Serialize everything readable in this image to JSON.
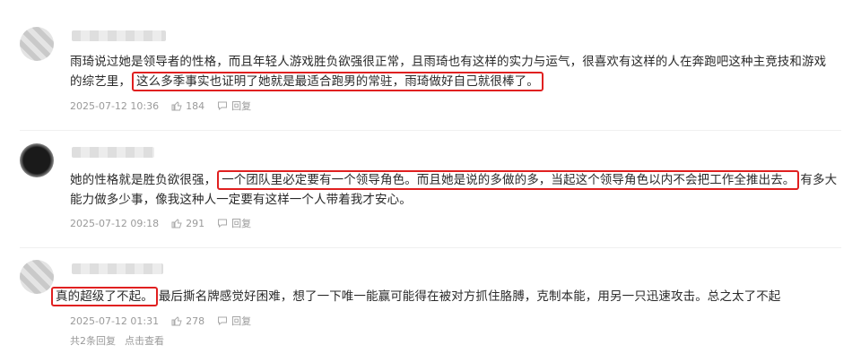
{
  "comments": [
    {
      "line1": "雨琦说过她是领导者的性格，而且年轻人游戏胜负欲强很正常，且雨琦也有这样的实力与运气，很喜欢有这样的人在奔跑吧这种主竞技和游戏",
      "line2_pre": "的综艺里，",
      "line2_highlight": "这么多季事实也证明了她就是最适合跑男的常驻，雨琦做好自己就很棒了。",
      "time": "2025-07-12 10:36",
      "likes": "184",
      "reply_label": "回复"
    },
    {
      "line1_pre": "她的性格就是胜负欲很强，",
      "line1_highlight": "一个团队里必定要有一个领导角色。而且她是说的多做的多，当起这个领导角色以内不会把工作全推出去。",
      "line1_post": "有多大",
      "line2": "能力做多少事，像我这种人一定要有这样一个人带着我才安心。",
      "time": "2025-07-12 09:18",
      "likes": "291",
      "reply_label": "回复"
    },
    {
      "line1_highlight": "真的超级了不起。",
      "line1_post": "最后撕名牌感觉好困难，想了一下唯一能赢可能得在被对方抓住胳膊，克制本能，用另一只迅速攻击。总之太了不起",
      "time": "2025-07-12 01:31",
      "likes": "278",
      "reply_label": "回复"
    }
  ],
  "thread_footer": {
    "reply_count": "共2条回复",
    "view_link": "点击查看"
  }
}
